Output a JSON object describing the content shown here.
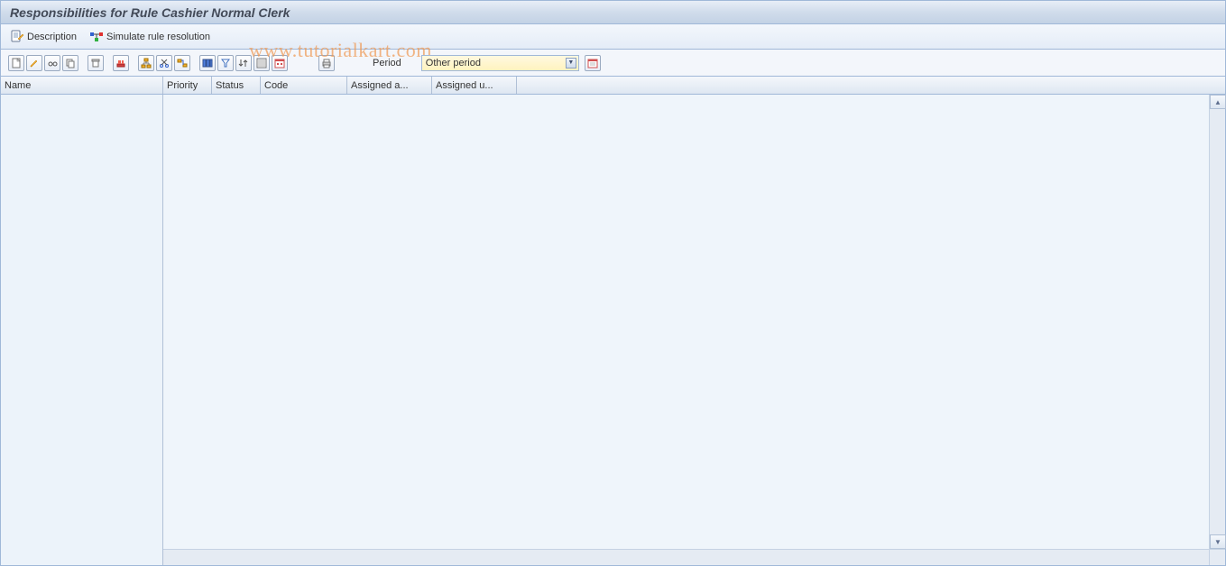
{
  "title": "Responsibilities for Rule Cashier Normal Clerk",
  "actions": {
    "description": "Description",
    "simulate": "Simulate rule resolution"
  },
  "watermark": "www.tutorialkart.com",
  "toolbar": {
    "period_label": "Period",
    "period_value": "Other period"
  },
  "columns": {
    "name": "Name",
    "priority": "Priority",
    "status": "Status",
    "code": "Code",
    "assigned_a": "Assigned a...",
    "assigned_u": "Assigned u..."
  },
  "rows": []
}
